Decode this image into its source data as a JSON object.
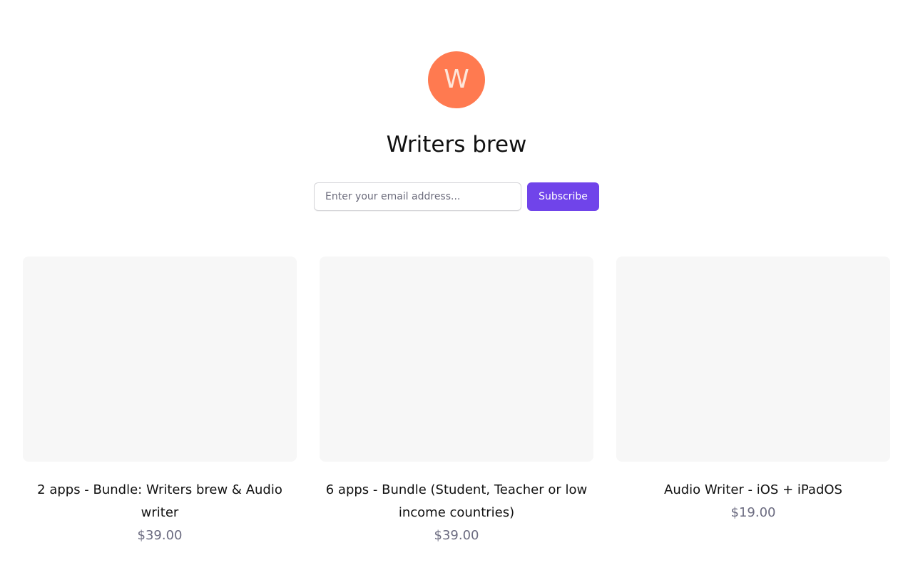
{
  "brand": {
    "avatar_letter": "W",
    "avatar_color": "#ff7a50",
    "name": "Writers brew"
  },
  "subscribe": {
    "email_placeholder": "Enter your email address...",
    "button_label": "Subscribe",
    "button_color": "#7044ea"
  },
  "products": [
    {
      "name": "2 apps - Bundle: Writers brew & Audio writer",
      "price": "$39.00"
    },
    {
      "name": "6 apps - Bundle (Student, Teacher or low income countries)",
      "price": "$39.00"
    },
    {
      "name": "Audio Writer - iOS + iPadOS",
      "price": "$19.00"
    }
  ]
}
